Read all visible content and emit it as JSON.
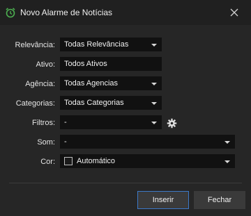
{
  "window": {
    "title": "Novo Alarme de Notícias"
  },
  "icons": {
    "app": "alarm-clock-icon",
    "close": "close-icon",
    "settings": "gear-icon"
  },
  "form": {
    "relevancia": {
      "label": "Relevância:",
      "value": "Todas Relevâncias"
    },
    "ativo": {
      "label": "Ativo:",
      "value": "Todos Ativos"
    },
    "agencia": {
      "label": "Agência:",
      "value": "Todas Agencias"
    },
    "categorias": {
      "label": "Categorias:",
      "value": "Todas Categorias"
    },
    "filtros": {
      "label": "Filtros:",
      "value": "-"
    },
    "som": {
      "label": "Som:",
      "value": "-"
    },
    "cor": {
      "label": "Cor:",
      "value": "Automático"
    }
  },
  "buttons": {
    "insert": "Inserir",
    "close": "Fechar"
  },
  "colors": {
    "accent": "#3c79c8",
    "icon_green": "#4caf50",
    "background": "#262626",
    "field": "#111111"
  }
}
